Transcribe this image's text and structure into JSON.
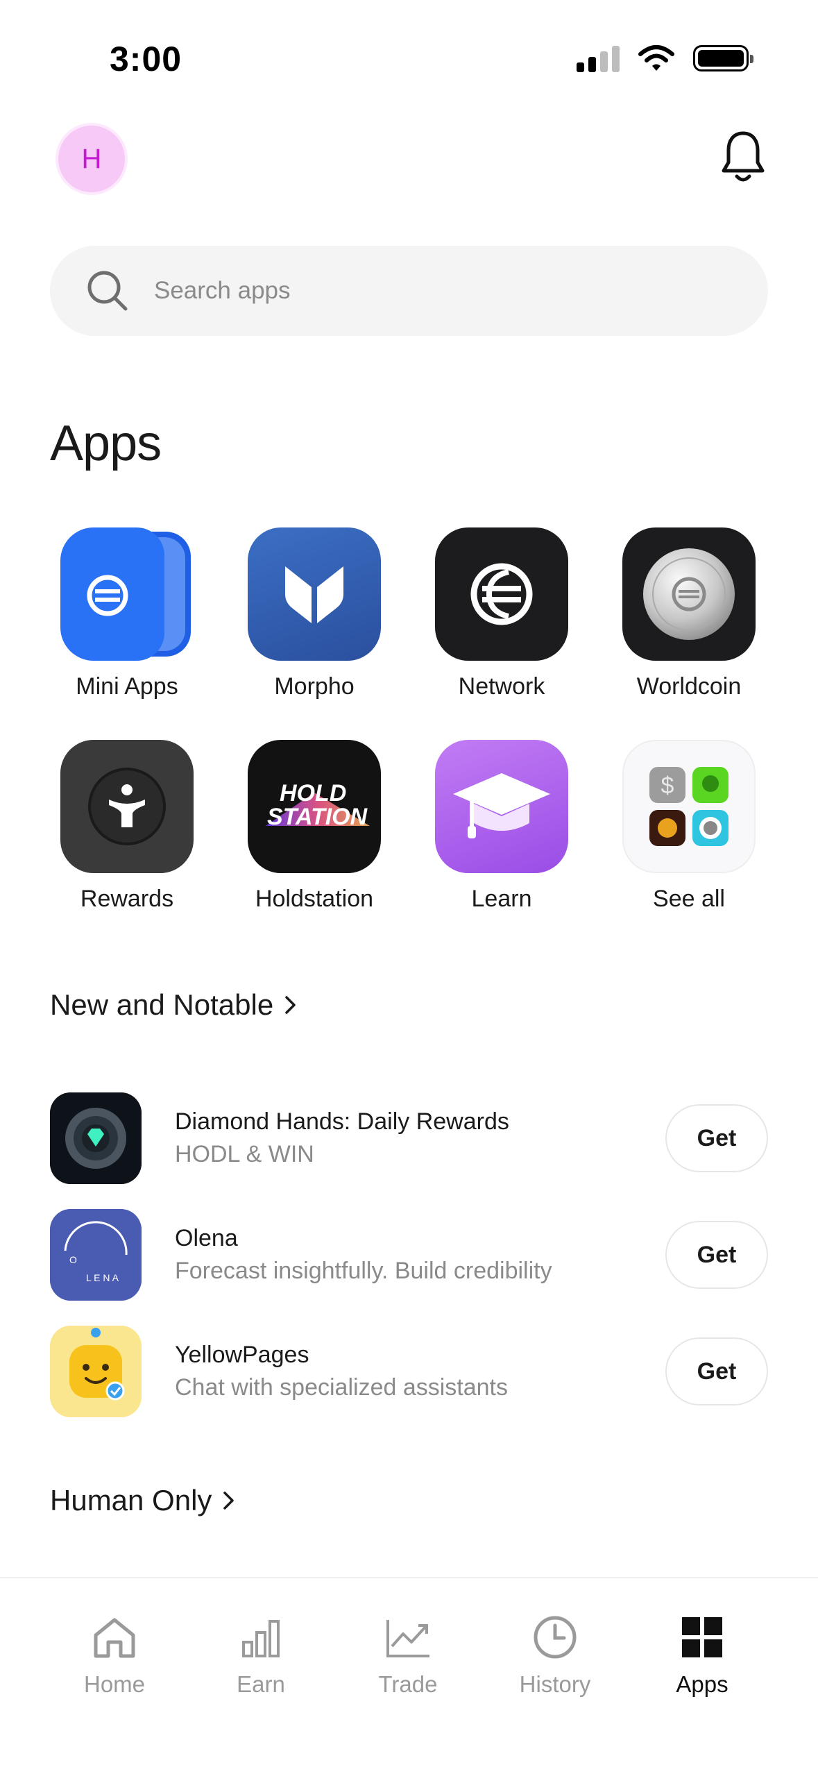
{
  "status_bar": {
    "time": "3:00"
  },
  "header": {
    "avatar_initial": "H"
  },
  "search": {
    "placeholder": "Search apps"
  },
  "apps_section": {
    "title": "Apps",
    "items": [
      {
        "label": "Mini Apps",
        "icon": "mini-apps-icon"
      },
      {
        "label": "Morpho",
        "icon": "morpho-butterfly-icon"
      },
      {
        "label": "Network",
        "icon": "worldcoin-logo-icon"
      },
      {
        "label": "Worldcoin",
        "icon": "silver-coin-icon"
      },
      {
        "label": "Rewards",
        "icon": "rewards-person-icon"
      },
      {
        "label": "Holdstation",
        "icon": "holdstation-logo",
        "logo_text": "HOLD STATION"
      },
      {
        "label": "Learn",
        "icon": "graduation-cap-icon"
      },
      {
        "label": "See all",
        "icon": "app-folder-icon"
      }
    ]
  },
  "new_and_notable": {
    "title": "New and Notable",
    "items": [
      {
        "title": "Diamond Hands: Daily Rewards",
        "subtitle": "HODL & WIN",
        "button": "Get",
        "icon": "diamond-hands-icon"
      },
      {
        "title": "Olena",
        "subtitle": "Forecast insightfully. Build credibility",
        "button": "Get",
        "icon": "olena-icon",
        "logo_text": "OLENA"
      },
      {
        "title": "YellowPages",
        "subtitle": "Chat with specialized assistants",
        "button": "Get",
        "icon": "yellowpages-smiley-icon"
      }
    ]
  },
  "human_only": {
    "title": "Human Only"
  },
  "bottom_nav": {
    "items": [
      {
        "label": "Home",
        "icon": "home-icon",
        "active": false
      },
      {
        "label": "Earn",
        "icon": "bar-chart-icon",
        "active": false
      },
      {
        "label": "Trade",
        "icon": "trend-chart-icon",
        "active": false
      },
      {
        "label": "History",
        "icon": "clock-icon",
        "active": false
      },
      {
        "label": "Apps",
        "icon": "grid-icon",
        "active": true
      }
    ]
  },
  "colors": {
    "avatar_bg": "#f7c9f7",
    "avatar_text": "#c41ad1",
    "search_bg": "#f4f4f4",
    "active_nav": "#111111",
    "inactive_nav": "#9a9a9a"
  }
}
